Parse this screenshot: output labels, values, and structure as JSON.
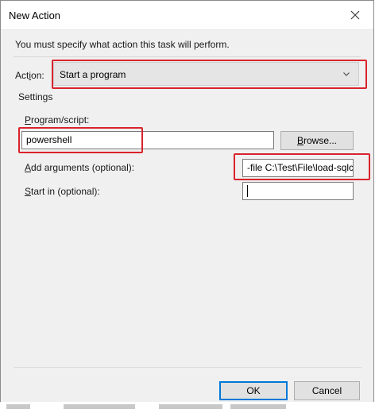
{
  "window": {
    "title": "New Action"
  },
  "instruction": "You must specify what action this task will perform.",
  "action": {
    "label_pre": "Act",
    "label_accel": "i",
    "label_post": "on:",
    "selected": "Start a program"
  },
  "settings": {
    "group_label": "Settings",
    "program": {
      "label_accel": "P",
      "label_rest": "rogram/script:",
      "value": "powershell"
    },
    "browse": {
      "label_accel": "B",
      "label_post": "rowse..."
    },
    "arguments": {
      "label_accel": "A",
      "label_rest": "dd arguments (optional):",
      "value": "-file C:\\Test\\File\\load-sqlc"
    },
    "start_in": {
      "label_accel": "S",
      "label_rest": "tart in (optional):",
      "value": ""
    }
  },
  "buttons": {
    "ok": "OK",
    "cancel": "Cancel"
  },
  "colors": {
    "highlight": "#d9232d",
    "accent": "#0078d7",
    "client_bg": "#f0f0f0"
  }
}
